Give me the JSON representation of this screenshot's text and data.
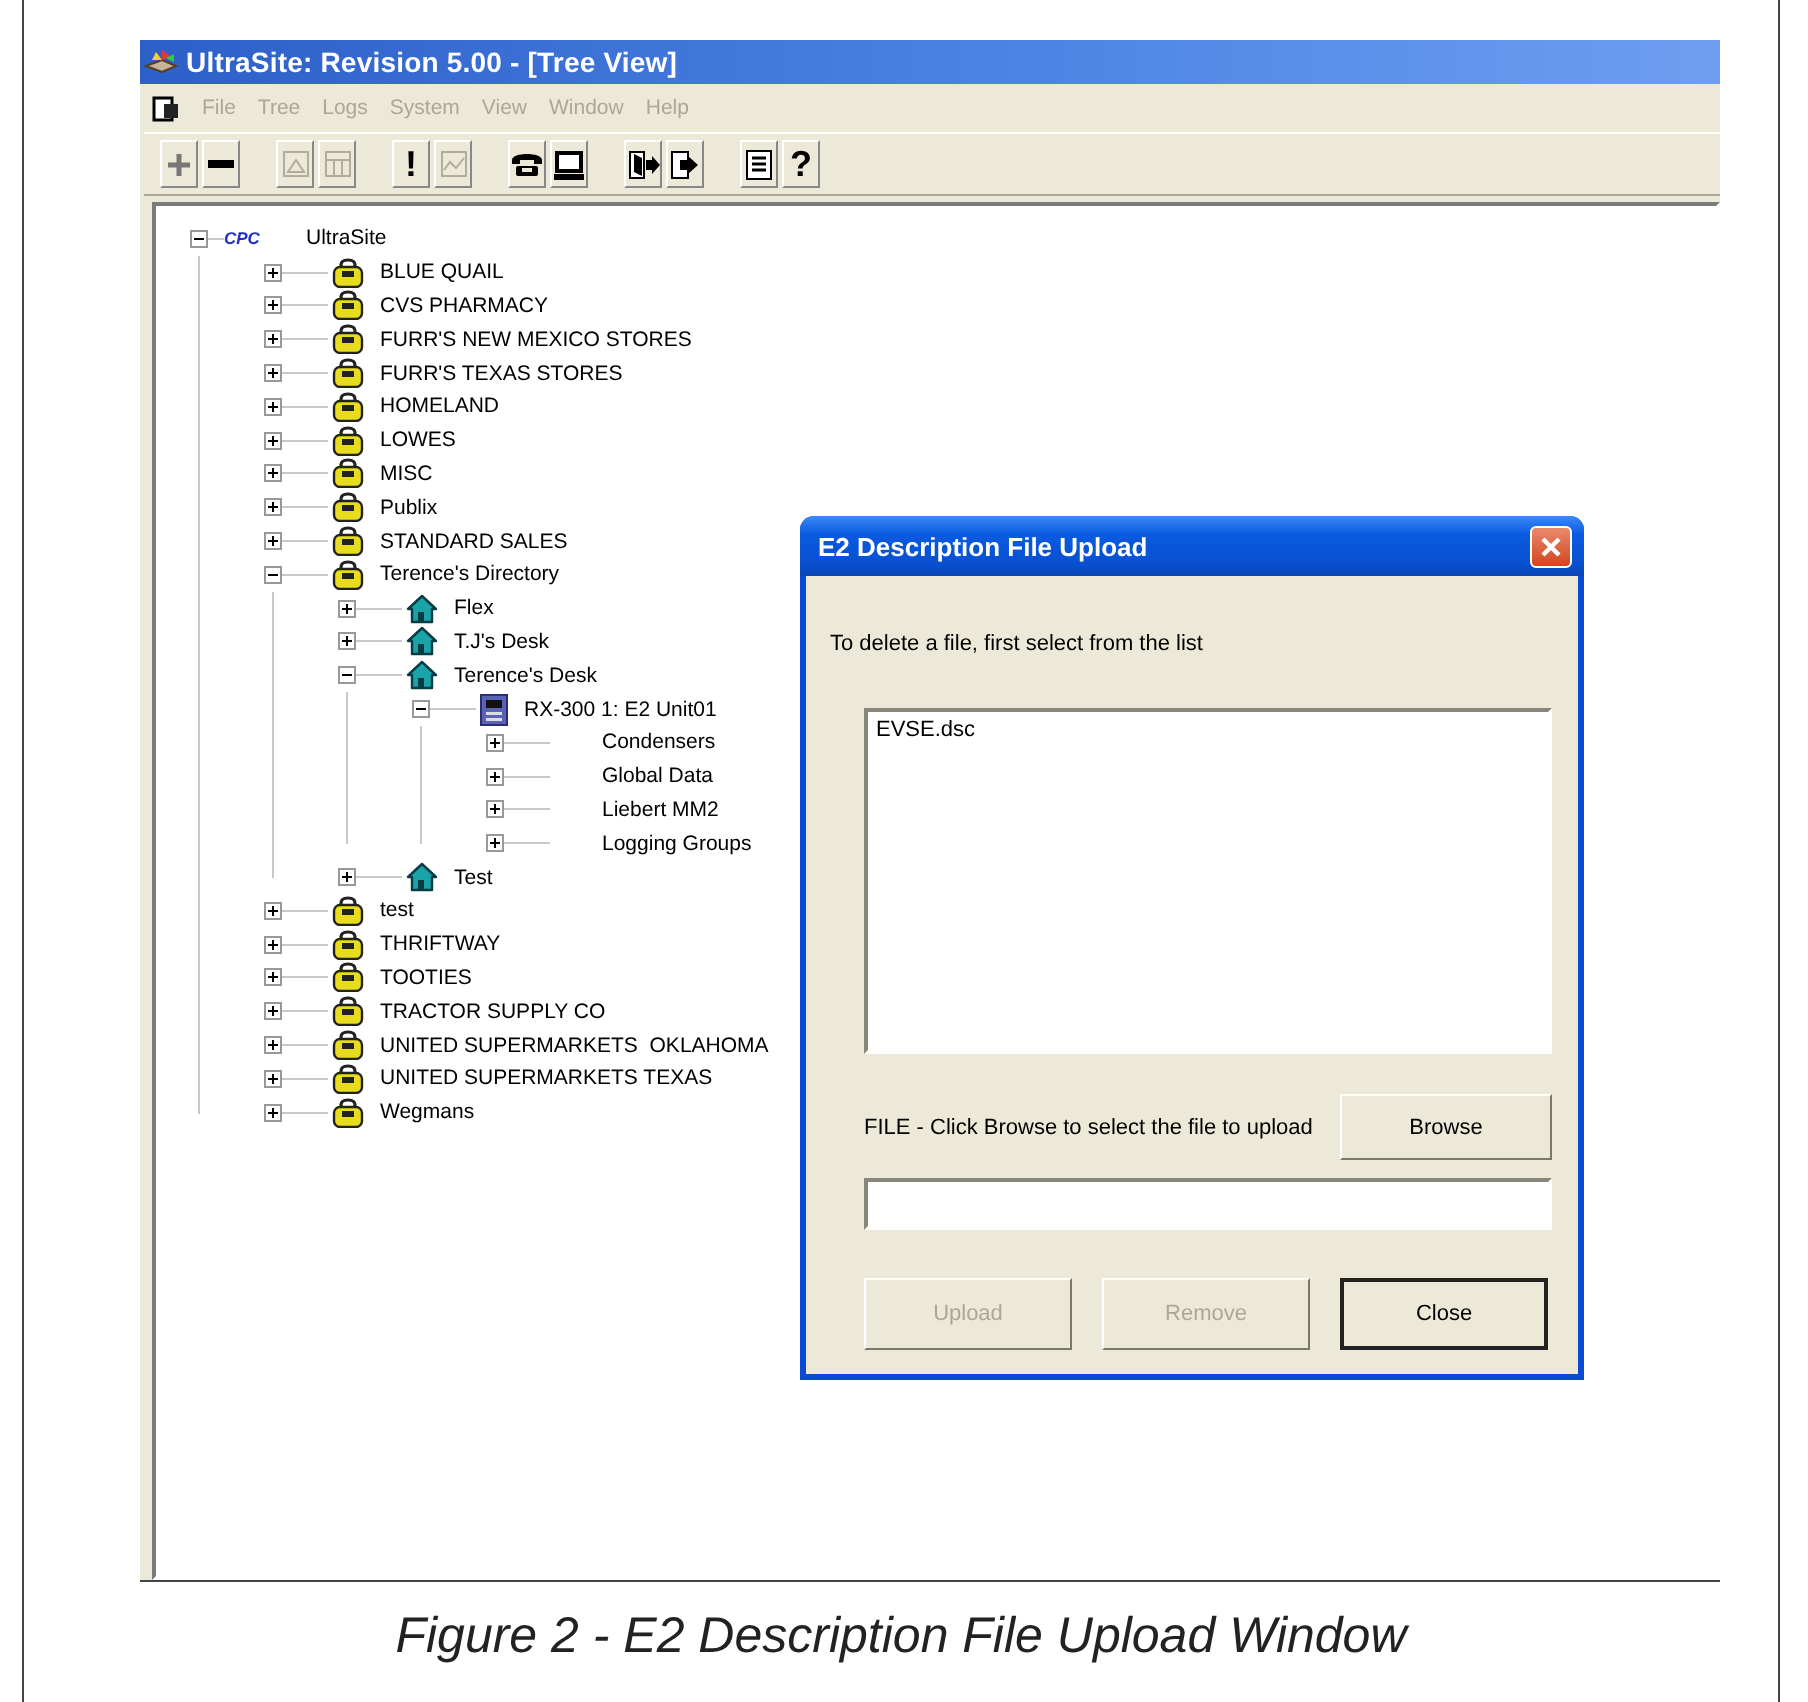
{
  "window": {
    "title": "UltraSite: Revision 5.00 - [Tree View]"
  },
  "menu": [
    {
      "label": "File",
      "disabled": true
    },
    {
      "label": "Tree",
      "disabled": true
    },
    {
      "label": "Logs",
      "disabled": true
    },
    {
      "label": "System",
      "disabled": true
    },
    {
      "label": "View",
      "disabled": true
    },
    {
      "label": "Window",
      "disabled": true
    },
    {
      "label": "Help",
      "disabled": true
    }
  ],
  "toolbar": {
    "groups": [
      {
        "buttons": [
          {
            "kind": "plus",
            "disabled": false
          },
          {
            "kind": "minus",
            "disabled": false
          }
        ]
      },
      {
        "buttons": [
          {
            "kind": "picture",
            "disabled": true
          },
          {
            "kind": "grid",
            "disabled": true
          }
        ]
      },
      {
        "buttons": [
          {
            "kind": "text",
            "label": "!",
            "disabled": false
          },
          {
            "kind": "chart",
            "disabled": true
          }
        ]
      },
      {
        "buttons": [
          {
            "kind": "phone",
            "disabled": false
          },
          {
            "kind": "monitor",
            "disabled": false
          }
        ]
      },
      {
        "buttons": [
          {
            "kind": "door-in",
            "disabled": false
          },
          {
            "kind": "door-out",
            "disabled": false
          }
        ]
      },
      {
        "buttons": [
          {
            "kind": "list",
            "disabled": false
          },
          {
            "kind": "text",
            "label": "?",
            "disabled": false
          }
        ]
      }
    ]
  },
  "tree": {
    "nodes": [
      {
        "kind": "root",
        "badge": "CPC",
        "label": "UltraSite",
        "expanded": true,
        "children": [
          {
            "kind": "company",
            "label": "BLUE QUAIL",
            "expanded": false
          },
          {
            "kind": "company",
            "label": "CVS PHARMACY",
            "expanded": false
          },
          {
            "kind": "company",
            "label": "FURR'S NEW MEXICO STORES",
            "expanded": false
          },
          {
            "kind": "company",
            "label": "FURR'S TEXAS STORES",
            "expanded": false
          },
          {
            "kind": "company",
            "label": "HOMELAND",
            "expanded": false
          },
          {
            "kind": "company",
            "label": "LOWES",
            "expanded": false
          },
          {
            "kind": "company",
            "label": "MISC",
            "expanded": false
          },
          {
            "kind": "company",
            "label": "Publix",
            "expanded": false
          },
          {
            "kind": "company",
            "label": "STANDARD SALES",
            "expanded": false
          },
          {
            "kind": "company",
            "label": "Terence's Directory",
            "expanded": true,
            "children": [
              {
                "kind": "site",
                "label": "Flex",
                "expanded": false
              },
              {
                "kind": "site",
                "label": "T.J's Desk",
                "expanded": false
              },
              {
                "kind": "site",
                "label": "Terence's Desk",
                "expanded": true,
                "children": [
                  {
                    "kind": "controller",
                    "label": "RX-300 1: E2 Unit01",
                    "expanded": true,
                    "children": [
                      {
                        "kind": "group",
                        "label": "Condensers",
                        "expanded": false
                      },
                      {
                        "kind": "group",
                        "label": "Global Data",
                        "expanded": false
                      },
                      {
                        "kind": "group",
                        "label": "Liebert MM2",
                        "expanded": false
                      },
                      {
                        "kind": "group",
                        "label": "Logging Groups",
                        "expanded": false
                      }
                    ]
                  }
                ]
              },
              {
                "kind": "site",
                "label": "Test",
                "expanded": false
              }
            ]
          },
          {
            "kind": "company",
            "label": "test",
            "expanded": false
          },
          {
            "kind": "company",
            "label": "THRIFTWAY",
            "expanded": false
          },
          {
            "kind": "company",
            "label": "TOOTIES",
            "expanded": false
          },
          {
            "kind": "company",
            "label": "TRACTOR SUPPLY CO",
            "expanded": false
          },
          {
            "kind": "company",
            "label": "UNITED SUPERMARKETS  OKLAHOMA",
            "expanded": false
          },
          {
            "kind": "company",
            "label": "UNITED SUPERMARKETS TEXAS",
            "expanded": false
          },
          {
            "kind": "company",
            "label": "Wegmans",
            "expanded": false
          }
        ]
      }
    ]
  },
  "dialog": {
    "title": "E2 Description File Upload",
    "instruction": "To delete a file, first select from the list",
    "files": [
      {
        "name": "EVSE.dsc",
        "selected": false
      }
    ],
    "file_label": "FILE - Click Browse to select the file to upload",
    "browse_button": "Browse",
    "buttons": [
      {
        "label": "Upload",
        "disabled": true,
        "default": false
      },
      {
        "label": "Remove",
        "disabled": true,
        "default": false
      },
      {
        "label": "Close",
        "disabled": false,
        "default": true
      }
    ]
  },
  "caption": "Figure 2 - E2 Description File Upload Window"
}
